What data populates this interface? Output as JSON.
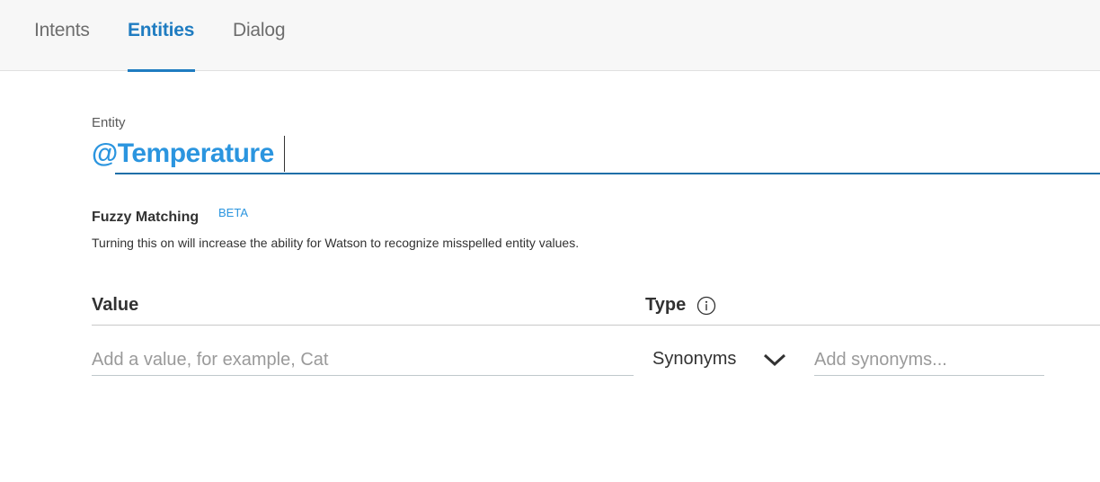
{
  "tabs": [
    {
      "label": "Intents",
      "active": false
    },
    {
      "label": "Entities",
      "active": true
    },
    {
      "label": "Dialog",
      "active": false
    }
  ],
  "entity": {
    "label": "Entity",
    "value": "@Temperature"
  },
  "fuzzy": {
    "title": "Fuzzy Matching",
    "badge": "BETA",
    "description": "Turning this on will increase the ability for Watson to recognize misspelled entity values."
  },
  "table": {
    "value_header": "Value",
    "type_header": "Type",
    "value_placeholder": "Add a value, for example, Cat",
    "type_selected": "Synonyms",
    "synonyms_placeholder": "Add synonyms..."
  },
  "colors": {
    "accent": "#1f7cc1",
    "entity_text": "#2b95df"
  },
  "icons": {
    "type_info": "info-icon",
    "type_dropdown": "chevron-down-icon"
  }
}
